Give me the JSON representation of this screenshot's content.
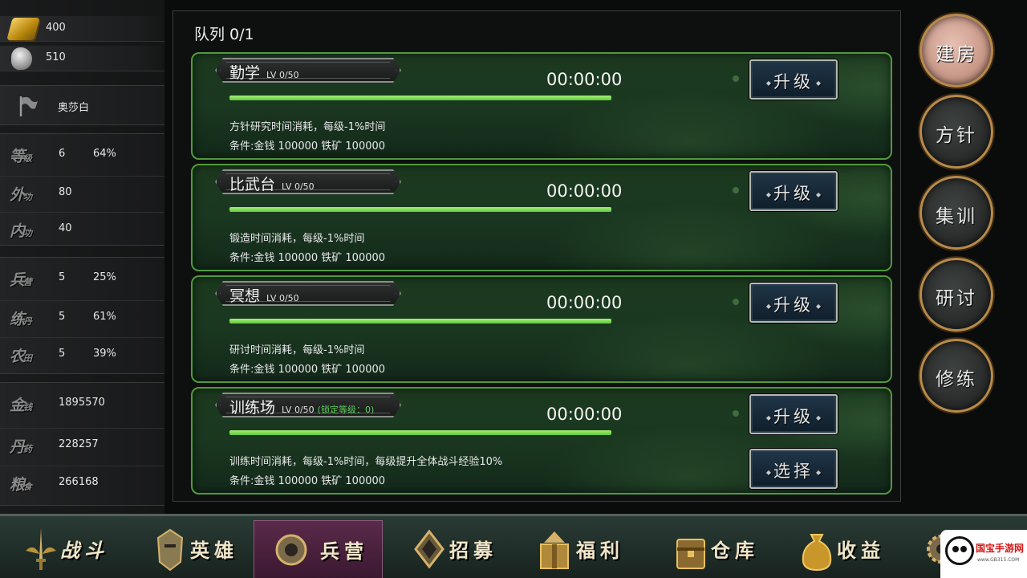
{
  "resources": {
    "gold_ingot": "400",
    "silver_ore": "510"
  },
  "player": {
    "name": "奥莎白"
  },
  "stats": [
    {
      "label": "等",
      "label_small": "级",
      "value": "6",
      "percent": "64%"
    },
    {
      "label": "外",
      "label_small": "功",
      "value": "80",
      "percent": ""
    },
    {
      "label": "内",
      "label_small": "功",
      "value": "40",
      "percent": ""
    }
  ],
  "buildings": [
    {
      "label": "兵",
      "label_small": "营",
      "value": "5",
      "percent": "25%"
    },
    {
      "label": "练",
      "label_small": "丹",
      "value": "5",
      "percent": "61%"
    },
    {
      "label": "农",
      "label_small": "田",
      "value": "5",
      "percent": "39%"
    }
  ],
  "wealth": [
    {
      "label": "金",
      "label_small": "钱",
      "value": "1895570"
    },
    {
      "label": "丹",
      "label_small": "药",
      "value": "228257"
    },
    {
      "label": "粮",
      "label_small": "食",
      "value": "266168"
    }
  ],
  "queue": {
    "title": "队列 0/1"
  },
  "cards": [
    {
      "name": "勤学",
      "level": "LV 0/50",
      "lock": "",
      "timer": "00:00:00",
      "progress": 1.0,
      "desc": "方针研究时间消耗，每级-1%时间",
      "cond": "条件:金钱 100000 铁矿 100000",
      "buttons": [
        "升级"
      ]
    },
    {
      "name": "比武台",
      "level": "LV 0/50",
      "lock": "",
      "timer": "00:00:00",
      "progress": 1.0,
      "desc": "锻造时间消耗，每级-1%时间",
      "cond": "条件:金钱 100000 铁矿 100000",
      "buttons": [
        "升级"
      ]
    },
    {
      "name": "冥想",
      "level": "LV 0/50",
      "lock": "",
      "timer": "00:00:00",
      "progress": 1.0,
      "desc": "研讨时间消耗，每级-1%时间",
      "cond": "条件:金钱 100000 铁矿 100000",
      "buttons": [
        "升级"
      ]
    },
    {
      "name": "训练场",
      "level": "LV 0/50",
      "lock": "(锁定等级：0)",
      "timer": "00:00:00",
      "progress": 1.0,
      "desc": "训练时间消耗，每级-1%时间，每级提升全体战斗经验10%",
      "cond": "条件:金钱 100000 铁矿 100000",
      "buttons": [
        "升级",
        "选择"
      ]
    }
  ],
  "side_tabs": [
    {
      "label": "建房",
      "active": true
    },
    {
      "label": "方针",
      "active": false
    },
    {
      "label": "集训",
      "active": false
    },
    {
      "label": "研讨",
      "active": false
    },
    {
      "label": "修练",
      "active": false
    }
  ],
  "bottom_nav": [
    {
      "label": "战斗",
      "icon": "sword-wings-icon",
      "active": false
    },
    {
      "label": "英雄",
      "icon": "helmet-icon",
      "active": false
    },
    {
      "label": "兵营",
      "icon": "barracks-shield-icon",
      "active": true
    },
    {
      "label": "招募",
      "icon": "diamond-banner-icon",
      "active": false
    },
    {
      "label": "福利",
      "icon": "gift-box-icon",
      "active": false
    },
    {
      "label": "仓库",
      "icon": "chest-icon",
      "active": false
    },
    {
      "label": "收益",
      "icon": "money-bag-icon",
      "active": false
    },
    {
      "label": "设置",
      "icon": "gear-icon",
      "active": false
    }
  ],
  "watermark": {
    "brand": "国宝手游网",
    "url": "www.GB315.COM"
  },
  "colors": {
    "card_border": "#4f9a3c",
    "progress": "#7ee05a",
    "active_tab": "#c89888",
    "lock_text": "#5ad05a",
    "nav_active": "#5a2a4a"
  }
}
